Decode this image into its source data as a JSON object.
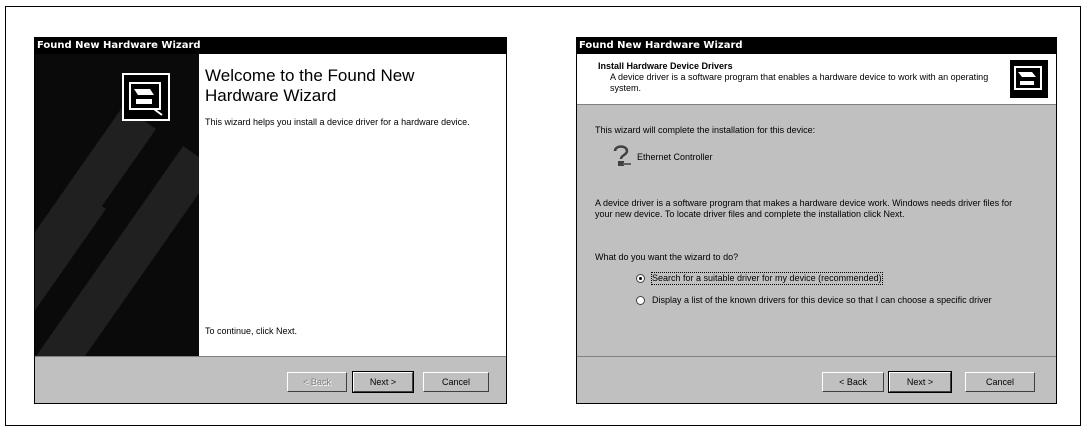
{
  "left_wizard": {
    "title": "Found New Hardware Wizard",
    "welcome_title": "Welcome to the Found New Hardware Wizard",
    "description": "This wizard helps you install a device driver for a hardware device.",
    "continue_text": "To continue, click Next.",
    "buttons": {
      "back": "< Back",
      "next": "Next >",
      "cancel": "Cancel"
    }
  },
  "right_wizard": {
    "title": "Found New Hardware Wizard",
    "header_title": "Install Hardware Device Drivers",
    "header_desc": "A device driver is a software program that enables a hardware device to work with an operating system.",
    "intro": "This wizard will complete the installation for this device:",
    "device_name": "Ethernet Controller",
    "driver_info": "A device driver is a software program that makes a hardware device work. Windows needs driver files for your new device. To locate driver files and complete the installation click Next.",
    "question": "What do you want the wizard to do?",
    "options": [
      {
        "label": "Search for a suitable driver for my device (recommended)",
        "selected": true
      },
      {
        "label": "Display a list of the known drivers for this device so that I can choose a specific driver",
        "selected": false
      }
    ],
    "buttons": {
      "back": "< Back",
      "next": "Next >",
      "cancel": "Cancel"
    }
  },
  "icons": [
    "hardware-wizard-icon",
    "question-device-icon"
  ]
}
